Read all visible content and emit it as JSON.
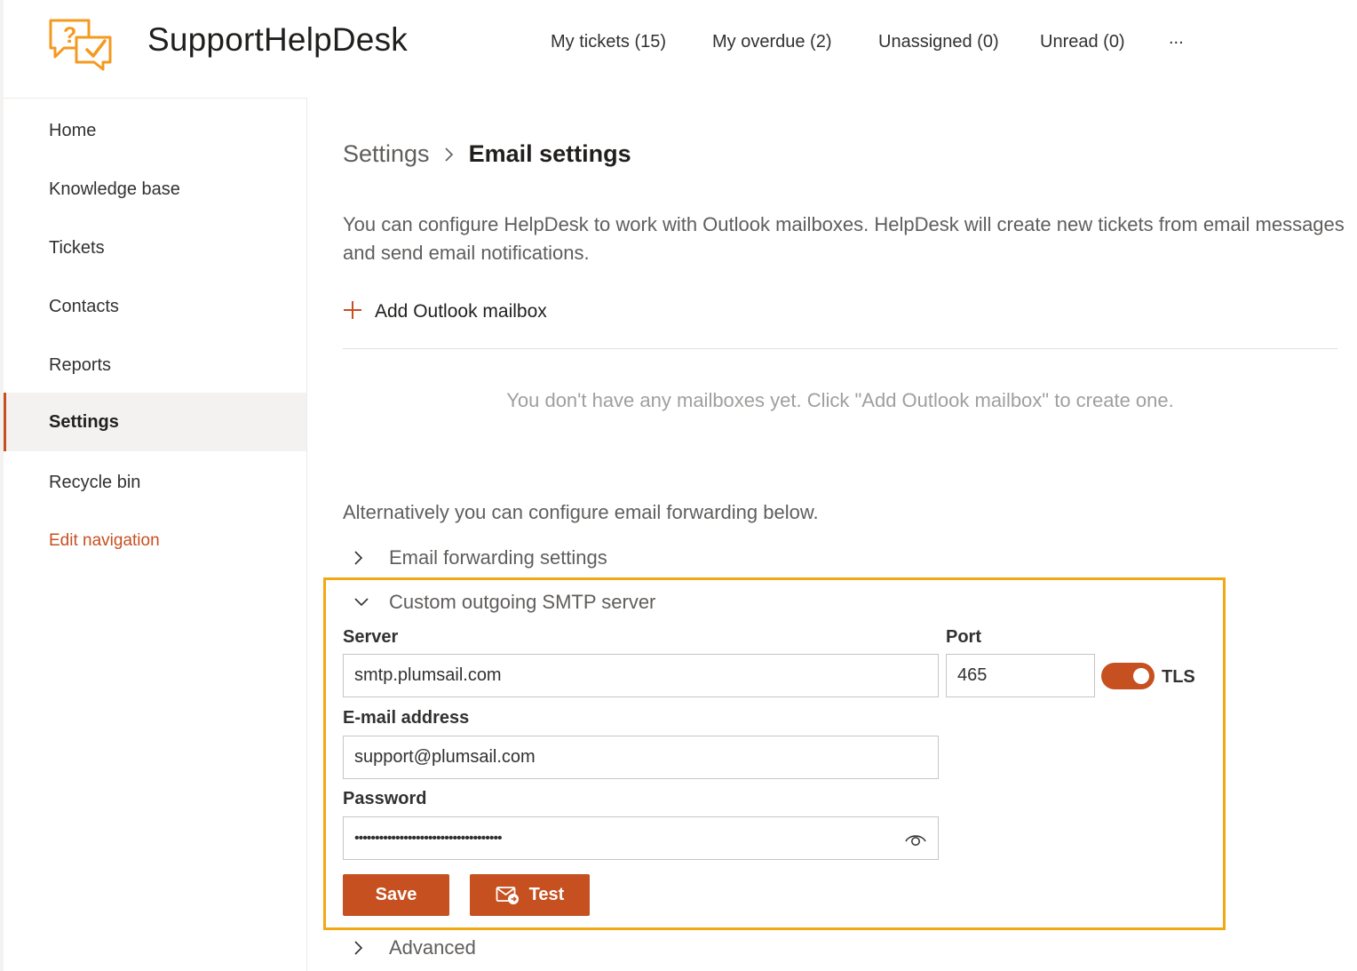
{
  "app": {
    "title": "SupportHelpDesk"
  },
  "topnav": {
    "items": [
      {
        "label": "My tickets (15)"
      },
      {
        "label": "My overdue (2)"
      },
      {
        "label": "Unassigned (0)"
      },
      {
        "label": "Unread (0)"
      },
      {
        "label": "..."
      }
    ]
  },
  "sidebar": {
    "items": [
      {
        "label": "Home"
      },
      {
        "label": "Knowledge base"
      },
      {
        "label": "Tickets"
      },
      {
        "label": "Contacts"
      },
      {
        "label": "Reports"
      },
      {
        "label": "Settings",
        "selected": true
      },
      {
        "label": "Recycle bin"
      }
    ],
    "edit_label": "Edit navigation"
  },
  "breadcrumb": {
    "parent": "Settings",
    "current": "Email settings"
  },
  "main": {
    "description": "You can configure HelpDesk to work with Outlook mailboxes. HelpDesk will create new tickets from email messages and send email notifications.",
    "add_mailbox_label": "Add Outlook mailbox",
    "empty_message": "You don't have any mailboxes yet. Click \"Add Outlook mailbox\" to create one.",
    "alternative_text": "Alternatively you can configure email forwarding below."
  },
  "sections": {
    "forwarding": {
      "label": "Email forwarding settings",
      "expanded": false
    },
    "smtp": {
      "label": "Custom outgoing SMTP server",
      "expanded": true
    },
    "advanced": {
      "label": "Advanced",
      "expanded": false
    }
  },
  "smtp": {
    "server_label": "Server",
    "server_value": "smtp.plumsail.com",
    "port_label": "Port",
    "port_value": "465",
    "tls_label": "TLS",
    "tls_enabled": true,
    "email_label": "E-mail address",
    "email_value": "support@plumsail.com",
    "password_label": "Password",
    "password_value": "••••••••••••••••••••••••••••••••••••",
    "save_label": "Save",
    "test_label": "Test"
  },
  "colors": {
    "accent": "#c65020",
    "highlight_border": "#f2a814",
    "logo": "#f39a1f"
  },
  "icons": {
    "logo": "helpdesk-logo-icon",
    "add": "plus-icon",
    "chevron_right": "chevron-right-icon",
    "chevron_down": "chevron-down-icon",
    "eye": "eye-icon",
    "test": "mail-test-icon"
  }
}
